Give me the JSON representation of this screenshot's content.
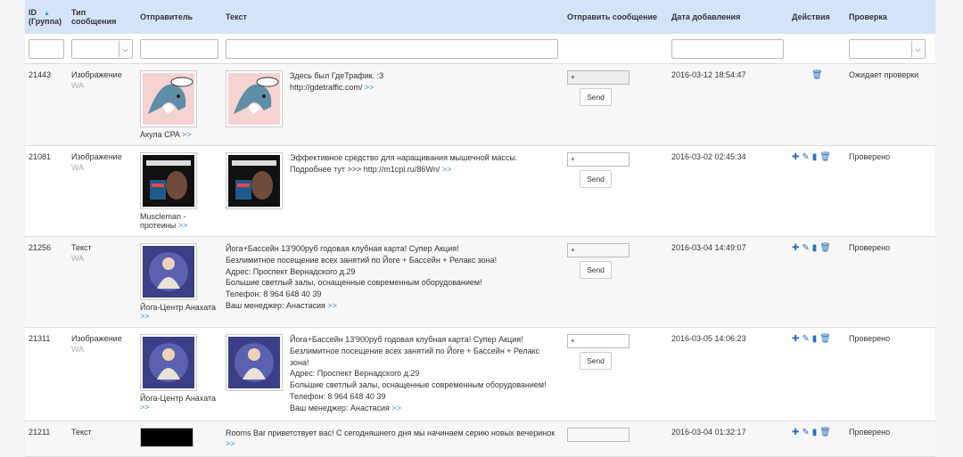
{
  "headers": {
    "id": "ID\n(Группа)",
    "type": "Тип\nсообщения",
    "sender": "Отправитель",
    "text": "Текст",
    "send": "Отправить сообщение",
    "date": "Дата добавления",
    "actions": "Действия",
    "check": "Проверка"
  },
  "send_label": "Send",
  "rows": [
    {
      "id": "21443",
      "type": "Изображение",
      "sub": "WA",
      "sender": "Акула CPA",
      "text": "Здесь был ГдеТрафик. :3\nhttp://gdetraffic.com/",
      "send_value": "+",
      "date": "2016-03-12 18:54:47",
      "status": "Ожидает проверки"
    },
    {
      "id": "21081",
      "type": "Изображение",
      "sub": "WA",
      "sender": "Muscleman -\nпротеины",
      "text": "Эффективное средство для наращивания мышечной массы. Подробнее тут >>> http://m1cpl.ru/86Wn/",
      "send_value": "+",
      "date": "2016-03-02 02:45:34",
      "status": "Проверено"
    },
    {
      "id": "21256",
      "type": "Текст",
      "sub": "WA",
      "sender": "Йога-Центр Анахата",
      "text": "Йога+Бассейн 13'900руб годовая клубная карта! Супер Акция!\nБезлимитное посещение всех занятий по Йоге + Бассейн + Релакс зона!\nАдрес: Проспект Вернадского д.29\nБольшие светлый залы, оснащенные современным оборудованием!\nТелефон: 8 964 648 40 39\nВаш менеджер: Анастасия",
      "send_value": "+",
      "date": "2016-03-04 14:49:07",
      "status": "Проверено"
    },
    {
      "id": "21311",
      "type": "Изображение",
      "sub": "WA",
      "sender": "Йога-Центр Анахата",
      "text": "Йога+Бассейн 13'900руб годовая клубная карта! Супер Акция!\nБезлимитное посещение всех занятий по Йоге + Бассейн + Релакс зона!\nАдрес: Проспект Вернадского д.29\nБольшие светлый залы, оснащенные современным оборудованием!\nТелефон: 8 964 648 40 39\nВаш менеджер: Анастасия",
      "send_value": "+",
      "date": "2016-03-05 14:06:23",
      "status": "Проверено"
    },
    {
      "id": "21211",
      "type": "Текст",
      "sub": "",
      "sender": "",
      "text": "Rooms Bar приветствует вас! С сегодняшнего дня мы начинаем серию новых вечеринок",
      "send_value": "",
      "date": "2016-03-04 01:32:17",
      "status": "Проверено"
    }
  ],
  "colors": {
    "header_bg": "#d4e3f7",
    "link": "#3a8fd6",
    "action_icon": "#2a6ebb"
  },
  "icons": [
    "plus-icon",
    "pencil-icon",
    "document-icon",
    "trash-icon"
  ]
}
